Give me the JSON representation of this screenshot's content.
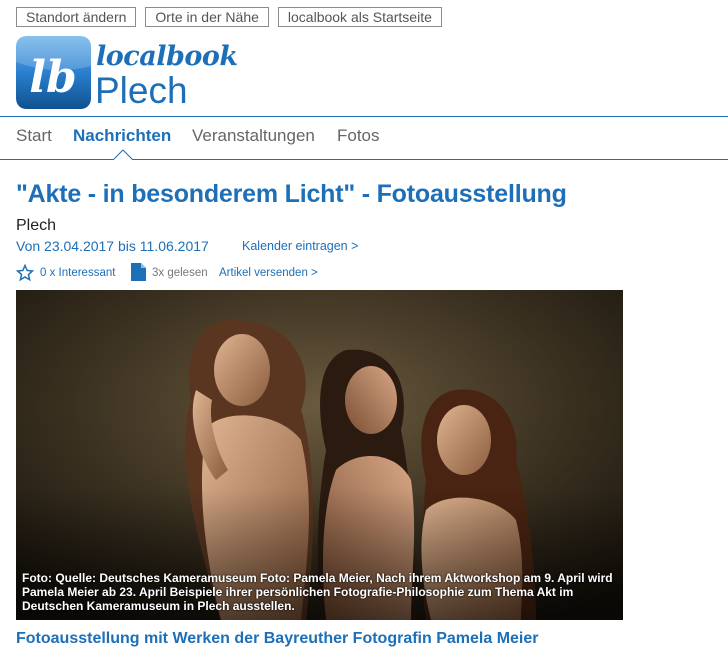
{
  "topbar": {
    "change_location": "Standort ändern",
    "nearby": "Orte in der Nähe",
    "set_homepage": "localbook als Startseite"
  },
  "brand": {
    "logo_letters": "lb",
    "name": "localbook",
    "city": "Plech"
  },
  "nav": {
    "items": [
      "Start",
      "Nachrichten",
      "Veranstaltungen",
      "Fotos"
    ],
    "active": "Nachrichten"
  },
  "article": {
    "title": "\"Akte - in besonderem Licht\" - Fotoausstellung",
    "location": "Plech",
    "dates": "Von 23.04.2017 bis 11.06.2017",
    "calendar_link": "Kalender eintragen >",
    "interesting": "0 x Interessant",
    "read_count": "3x gelesen",
    "send_article": "Artikel versenden >",
    "image_caption": "Foto: Quelle: Deutsches Kameramuseum Foto: Pamela Meier, Nach ihrem Aktworkshop am 9. April wird Pamela Meier ab 23. April Beispiele ihrer persönlichen Fotografie-Philosophie zum Thema Akt im Deutschen Kameramuseum in Plech ausstellen.",
    "subheading": "Fotoausstellung mit Werken der Bayreuther Fotografin Pamela Meier"
  },
  "colors": {
    "brand_blue": "#1d6fb8",
    "nav_grey": "#666666"
  }
}
